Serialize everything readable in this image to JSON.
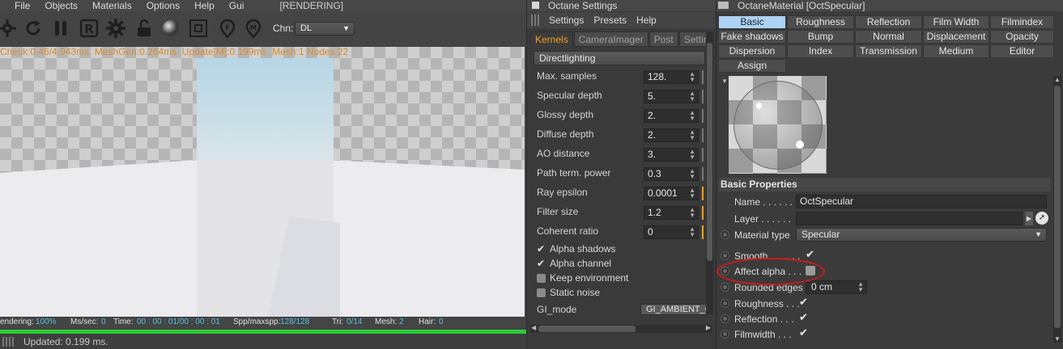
{
  "viewer": {
    "menu": [
      "File",
      "Objects",
      "Materials",
      "Options",
      "Help",
      "Gui"
    ],
    "status": "[RENDERING]",
    "channel_label": "Chn:",
    "channel_value": "DL",
    "debug_line": "Check:0.46/4.043ms. MeshGen:0.264ms. Update[M]:0.199ms. Mesh:1 Nodes:22",
    "stats": {
      "rendering_label": "endering:",
      "rendering_value": "100%",
      "mssec_label": "Ms/sec:",
      "mssec_value": "0",
      "time_label": "Time:",
      "time_value": "00 : 00 : 01/00 : 00 : 01",
      "spp_label": "Spp/maxspp:",
      "spp_value": "128/128",
      "tri_label": "Tri:",
      "tri_value": "0/14",
      "mesh_label": "Mesh:",
      "mesh_value": "2",
      "hair_label": "Hair:",
      "hair_value": "0"
    },
    "progress": 1.0,
    "progress_color": "#2ecc3a",
    "footer_status": "Updated: 0.199 ms.",
    "toolbar_icons": [
      "settings-gear-icon",
      "refresh-icon",
      "pause-icon",
      "region-render-icon",
      "preferences-gear-icon",
      "lock-icon",
      "material-ball-icon",
      "frame-icon",
      "focus-pick-icon",
      "material-pick-icon"
    ]
  },
  "settings": {
    "title": "Octane Settings",
    "menu": [
      "Settings",
      "Presets",
      "Help"
    ],
    "tabs": [
      "Kernels",
      "CameraImager",
      "Post",
      "Settings"
    ],
    "section": "Directlighting",
    "params": [
      {
        "label": "Max. samples",
        "value": "128."
      },
      {
        "label": "Specular depth",
        "value": "5."
      },
      {
        "label": "Glossy depth",
        "value": "2."
      },
      {
        "label": "Diffuse depth",
        "value": "2."
      },
      {
        "label": "AO distance",
        "value": "3."
      },
      {
        "label": "Path term. power",
        "value": "0.3"
      },
      {
        "label": "Ray epsilon",
        "value": "0.0001"
      },
      {
        "label": "Filter size",
        "value": "1.2"
      },
      {
        "label": "Coherent ratio",
        "value": "0"
      }
    ],
    "checks": [
      {
        "label": "Alpha shadows",
        "checked": true
      },
      {
        "label": "Alpha channel",
        "checked": true
      },
      {
        "label": "Keep environment",
        "checked": false
      },
      {
        "label": "Static noise",
        "checked": false
      }
    ],
    "gi_label": "GI_mode",
    "gi_value": "GI_AMBIENT_OC",
    "accent": "#f0a020"
  },
  "material": {
    "title": "OctaneMaterial [OctSpecular]",
    "tabs_row1": [
      "Basic",
      "Roughness",
      "Reflection",
      "Film Width",
      "Filmindex"
    ],
    "tabs_row2": [
      "Fake shadows",
      "Bump",
      "Normal",
      "Displacement",
      "Opacity"
    ],
    "tabs_row3": [
      "Dispersion",
      "Index",
      "Transmission",
      "Medium",
      "Editor"
    ],
    "tabs_row4": [
      "Assign"
    ],
    "active_tab_color": "#aed2f4",
    "section": "Basic Properties",
    "name_label": "Name . . . . . .",
    "name_value": "OctSpecular",
    "layer_label": "Layer . . . . . .",
    "layer_value": "",
    "type_label": "Material type",
    "type_value": "Specular",
    "smooth_label": "Smooth . . . . . .",
    "affect_alpha_label": "Affect alpha . . .",
    "rounded_label": "Rounded edges",
    "rounded_value": "0 cm",
    "roughness_label": "Roughness . . .",
    "reflection_label": "Reflection . . .",
    "filmwidth_label": "Filmwidth . . .",
    "check": "✔",
    "highlight_color": "#d21a1a"
  }
}
